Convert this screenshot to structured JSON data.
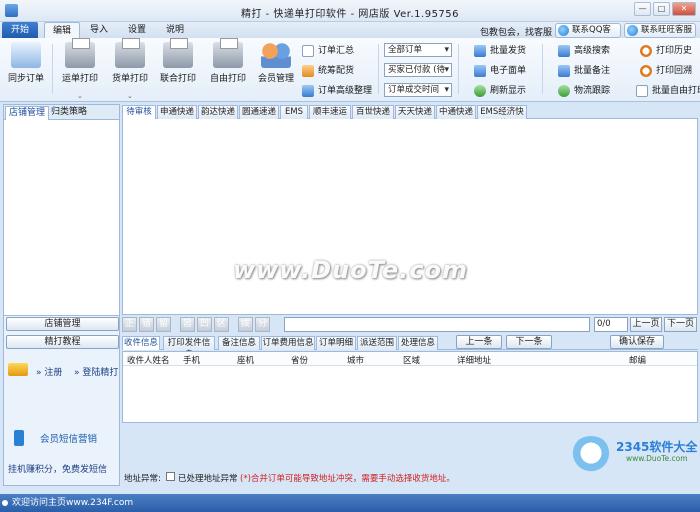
{
  "window": {
    "title": "精打 - 快递单打印软件 - 网店版 Ver.1.95756",
    "buttons": [
      "—",
      "□",
      "✕"
    ]
  },
  "menu_tabs": [
    {
      "label": "开始"
    },
    {
      "label": "编辑"
    },
    {
      "label": "导入"
    },
    {
      "label": "设置"
    },
    {
      "label": "说明"
    }
  ],
  "header": {
    "tip": "包教包会，找客服",
    "qq_service": "联系QQ客服",
    "wangwang_service": "联系旺旺客服"
  },
  "ribbon": {
    "sync_order": "同步订单",
    "waybill_print": "运单打印",
    "goods_print": "货单打印",
    "combined_print": "联合打印",
    "free_print": "自由打印",
    "member_manage": "会员管理",
    "order_summary": "订单汇总",
    "allocate": "统筹配货",
    "advanced_order": "订单高级整理",
    "select_all_orders": "全部订单",
    "select_paid": "买家已付款 (待",
    "select_time": "订单成交时间",
    "batch_ship": "批量发货",
    "e_waybill": "电子面单",
    "refresh": "刷新显示",
    "advanced_search": "高级搜索",
    "batch_note": "批量备注",
    "logistics_track": "物流跟踪",
    "print_history": "打印历史",
    "print_rollback": "打印回溯",
    "batch_free_print": "批量自由打印"
  },
  "left_panel": {
    "tabs": [
      {
        "label": "店铺管理"
      },
      {
        "label": "归类策略"
      }
    ],
    "store_manage_btn": "店铺管理",
    "tutorial_btn": "精打教程",
    "register": "注册",
    "login": "登陆精打",
    "sms_marketing": "会员短信营销",
    "earn_points": "挂机赚积分，免费发短信"
  },
  "courier_tabs": [
    {
      "label": "待审核"
    },
    {
      "label": "申通快递"
    },
    {
      "label": "韵达快递"
    },
    {
      "label": "圆通速递"
    },
    {
      "label": "EMS"
    },
    {
      "label": "顺丰速运"
    },
    {
      "label": "百世快递"
    },
    {
      "label": "天天快递"
    },
    {
      "label": "中通快递"
    },
    {
      "label": "EMS经济快递"
    }
  ],
  "watermark": "www.DuoTe.com",
  "pager": {
    "value": "0/0",
    "prev": "上一页",
    "next": "下一页"
  },
  "detail_tabs": [
    {
      "label": "收件信息"
    },
    {
      "label": "打印发件信息"
    },
    {
      "label": "备注信息"
    },
    {
      "label": "订单费用信息"
    },
    {
      "label": "订单明细"
    },
    {
      "label": "派送范围"
    },
    {
      "label": "处理信息"
    }
  ],
  "detail_nav": {
    "prev": "上一条",
    "next": "下一条",
    "confirm": "确认保存"
  },
  "table_headers": [
    "收件人姓名",
    "手机",
    "座机",
    "省份",
    "城市",
    "区域",
    "详细地址",
    "邮编"
  ],
  "address": {
    "label": "地址异常:",
    "checkbox_label": "已处理地址异常",
    "warning": "(*)合并订单可能导致地址冲突，需要手动选择收货地址。"
  },
  "status_bar": {
    "text": "欢迎访问主页www.234F.com"
  },
  "logo": {
    "brand": "2345软件大全",
    "url": "www.DuoTe.com"
  }
}
